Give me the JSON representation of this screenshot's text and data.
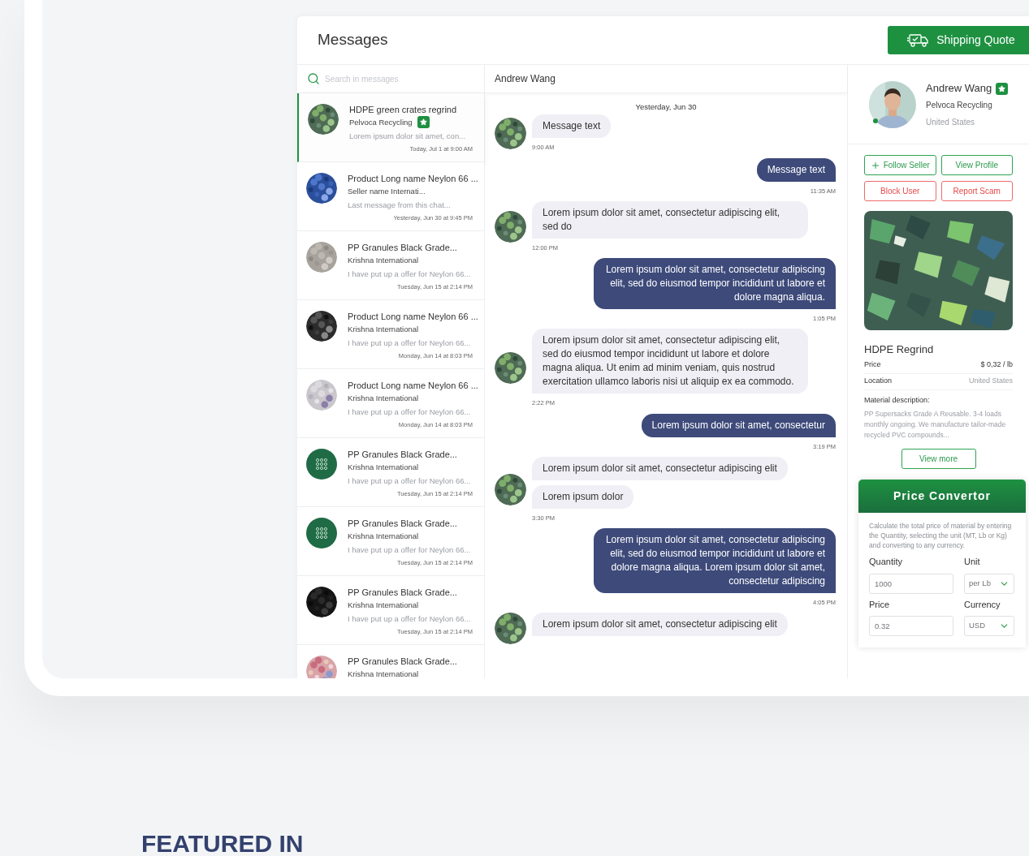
{
  "header": {
    "title": "Messages",
    "shipping_button": "Shipping Quote"
  },
  "search": {
    "placeholder": "Search in messages"
  },
  "conversations": [
    {
      "title": "HDPE green crates regrind",
      "seller": "Pelvoca Recycling",
      "verified": true,
      "preview": "Lorem ipsum dolor sit amet, con...",
      "time": "Today, Jul 1 at 9:00 AM",
      "selected": true,
      "kind": "picture"
    },
    {
      "title": "Product Long name Neylon 66 ...",
      "seller": "Seller name  Internati...",
      "verified": false,
      "preview": "Last message from this chat...",
      "time": "Yesterday, Jun 30 at 9:45 PM",
      "selected": false,
      "kind": "picture"
    },
    {
      "title": "PP Granules Black Grade...",
      "seller": "Krishna International",
      "verified": false,
      "preview": "I have put up a offer for Neylon 66...",
      "time": "Tuesday, Jun 15 at 2:14 PM",
      "selected": false,
      "kind": "picture"
    },
    {
      "title": "Product Long name Neylon 66 ...",
      "seller": "Krishna International",
      "verified": false,
      "preview": "I have put up a offer for Neylon 66...",
      "time": "Monday, Jun 14 at 8:03 PM",
      "selected": false,
      "kind": "picture"
    },
    {
      "title": "Product Long name Neylon 66 ...",
      "seller": "Krishna International",
      "verified": false,
      "preview": "I have put up a offer for Neylon 66...",
      "time": "Monday, Jun 14 at 8:03 PM",
      "selected": false,
      "kind": "picture"
    },
    {
      "title": "PP Granules Black Grade...",
      "seller": "Krishna International",
      "verified": false,
      "preview": "I have put up a offer for Neylon 66...",
      "time": "Tuesday, Jun 15 at 2:14 PM",
      "selected": false,
      "kind": "logo"
    },
    {
      "title": "PP Granules Black Grade...",
      "seller": "Krishna International",
      "verified": false,
      "preview": "I have put up a offer for Neylon 66...",
      "time": "Tuesday, Jun 15 at 2:14 PM",
      "selected": false,
      "kind": "logo"
    },
    {
      "title": "PP Granules Black Grade...",
      "seller": "Krishna International",
      "verified": false,
      "preview": "I have put up a offer for Neylon 66...",
      "time": "Tuesday, Jun 15 at 2:14 PM",
      "selected": false,
      "kind": "picture"
    },
    {
      "title": "PP Granules Black Grade...",
      "seller": "Krishna International",
      "verified": false,
      "selected": false,
      "kind": "picture"
    }
  ],
  "chat": {
    "contact": "Andrew Wang",
    "date": "Yesterday, Jun 30",
    "messages": [
      {
        "kind": "incoming",
        "bubbles": [
          "Message text"
        ],
        "time": "9:00 AM"
      },
      {
        "kind": "outgoing",
        "bubbles": [
          "Message text"
        ],
        "time": "11:35 AM"
      },
      {
        "kind": "incoming",
        "bubbles": [
          "Lorem ipsum dolor sit amet, consectetur adipiscing elit, sed do"
        ],
        "time": "12:00 PM"
      },
      {
        "kind": "outgoing",
        "bubbles": [
          "Lorem ipsum dolor sit amet, consectetur adipiscing elit, sed do eiusmod tempor incididunt ut labore et dolore magna aliqua."
        ],
        "time": "1:05 PM"
      },
      {
        "kind": "incoming",
        "bubbles": [
          "Lorem ipsum dolor sit amet, consectetur adipiscing elit, sed do eiusmod tempor incididunt ut labore et dolore magna aliqua. Ut enim ad minim veniam, quis nostrud exercitation ullamco laboris nisi ut aliquip ex ea commodo."
        ],
        "time": "2:22 PM"
      },
      {
        "kind": "outgoing",
        "bubbles": [
          "Lorem ipsum dolor sit amet, consectetur"
        ],
        "time": "3:19 PM"
      },
      {
        "kind": "incoming",
        "bubbles": [
          "Lorem ipsum dolor sit amet, consectetur adipiscing elit",
          "Lorem ipsum dolor"
        ],
        "time": "3:30 PM"
      },
      {
        "kind": "outgoing",
        "bubbles": [
          "Lorem ipsum dolor sit amet, consectetur adipiscing elit, sed do eiusmod tempor incididunt ut labore et dolore magna aliqua. Lorem ipsum dolor sit amet, consectetur adipiscing"
        ],
        "time": "4:05 PM"
      },
      {
        "kind": "incoming",
        "bubbles": [
          "Lorem ipsum dolor sit amet, consectetur adipiscing elit"
        ]
      }
    ]
  },
  "profile": {
    "name": "Andrew Wang",
    "verified": true,
    "online": true,
    "company": "Pelvoca Recycling",
    "country": "United States"
  },
  "actions": [
    {
      "label": "Follow Seller",
      "kind": "follow"
    },
    {
      "label": "View Profile",
      "kind": "positive"
    },
    {
      "label": "Block User",
      "kind": "danger"
    },
    {
      "label": "Report Scam",
      "kind": "danger"
    }
  ],
  "product": {
    "title": "HDPE Regrind",
    "details": [
      {
        "label": "Price",
        "value": "$ 0,32 / lb"
      },
      {
        "label": "Location",
        "value": "United States"
      }
    ],
    "description_label": "Material description:",
    "description": "PP Supersacks Grade A Reusable. 3-4 loads monthly ongoing. We manufacture tailor-made recycled PVC compounds...",
    "view_more": "View more"
  },
  "converter": {
    "title": "Price Convertor",
    "description": "Calculate the total price of material by entering the Quantity, selecting the unit (MT, Lb or Kg) and converting to any currency.",
    "fields": [
      {
        "label": "Quantity",
        "kind": "input",
        "value": "1000"
      },
      {
        "label": "Unit",
        "kind": "select",
        "value": "per Lb"
      },
      {
        "label": "Price",
        "kind": "input",
        "value": "0.32"
      },
      {
        "label": "Currency",
        "kind": "select",
        "value": "USD"
      }
    ]
  },
  "featured": {
    "title": "FEATURED IN"
  }
}
